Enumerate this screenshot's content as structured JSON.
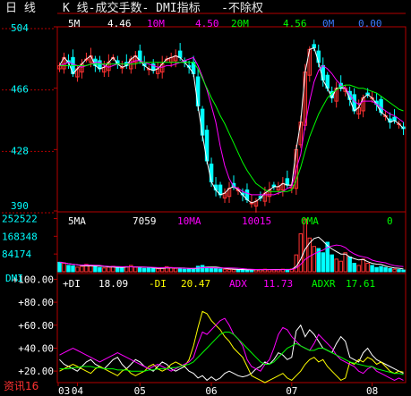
{
  "header": {
    "period": "日 线",
    "title": "K 线-成交手数- DMI指标   -不除权"
  },
  "price_legend": {
    "ma5_label": "5M",
    "ma5_value": "4.46",
    "ma10_label": "10M",
    "ma10_value": "4.50",
    "ma20_label": "20M",
    "ma20_value": "4.56",
    "ma0_label": "0M",
    "ma0_value": "0.00"
  },
  "volume_legend": {
    "ma5_label": "5MA",
    "ma5_value": "7059",
    "ma10_label": "10MA",
    "ma10_value": "10015",
    "ma0_label": "0MA",
    "ma0_value": "0"
  },
  "dmi_legend": {
    "pdi_label": "+DI",
    "pdi_value": "18.09",
    "mdi_label": "-DI",
    "mdi_value": "20.47",
    "adx_label": "ADX",
    "adx_value": "11.73",
    "adxr_label": "ADXR",
    "adxr_value": "17.61"
  },
  "panel_labels": {
    "dmi": "DMI"
  },
  "footer": {
    "brand": "资讯16"
  },
  "colors": {
    "up": "#ff3232",
    "down": "#00ffff",
    "ma5": "#ffffff",
    "ma10": "#ff00ff",
    "ma20": "#00ff00",
    "axis": "#b40000",
    "ylabel": "#00ffff",
    "pdi": "#ffffff",
    "mdi": "#ffff00",
    "adx": "#ff00ff",
    "adxr": "#00ff00"
  },
  "chart_data": [
    {
      "type": "candlestick",
      "ylim": [
        390,
        504
      ],
      "y_ticks": [
        "504",
        "466",
        "428",
        "390"
      ],
      "x_ticks": [
        "03",
        "04",
        "05",
        "06",
        "07",
        "08"
      ],
      "series": [
        {
          "name": "5M",
          "values": [
            480,
            485,
            482,
            475,
            478,
            481,
            484,
            486,
            480,
            478,
            479,
            482,
            485,
            481,
            479,
            480,
            484,
            486,
            483,
            480,
            478,
            477,
            478,
            481,
            484,
            485,
            486,
            485,
            482,
            479,
            475,
            455,
            437,
            421,
            408,
            403,
            400,
            401,
            404,
            405,
            403,
            400,
            397,
            395,
            396,
            398,
            401,
            403,
            405,
            405,
            407,
            406,
            406,
            428,
            445,
            476,
            490,
            491,
            482,
            471,
            466,
            460,
            466,
            466,
            466,
            459,
            452,
            454,
            460,
            462,
            460,
            456,
            451,
            449,
            445,
            446,
            444,
            441
          ]
        },
        {
          "name": "10M",
          "values": [
            480,
            481,
            482,
            481,
            480,
            479,
            480,
            481,
            482,
            482,
            480,
            479,
            480,
            481,
            481,
            481,
            482,
            483,
            483,
            482,
            481,
            480,
            479,
            479,
            480,
            480,
            481,
            482,
            483,
            484,
            485,
            480,
            473,
            465,
            455,
            445,
            430,
            418,
            410,
            405,
            404,
            402,
            401,
            400,
            400,
            400,
            400,
            400,
            400,
            401,
            402,
            404,
            405,
            416,
            425,
            443,
            458,
            470,
            477,
            480,
            478,
            475,
            471,
            468,
            466,
            462,
            458,
            456,
            458,
            458,
            458,
            456,
            454,
            452,
            450,
            449,
            447,
            445
          ]
        },
        {
          "name": "20M",
          "values": [
            480,
            480,
            480,
            480,
            480,
            480,
            480,
            481,
            481,
            481,
            481,
            481,
            481,
            481,
            481,
            481,
            481,
            481,
            482,
            482,
            482,
            482,
            482,
            482,
            482,
            482,
            482,
            482,
            482,
            482,
            482,
            478,
            472,
            466,
            460,
            455,
            449,
            444,
            438,
            432,
            426,
            420,
            415,
            411,
            407,
            405,
            403,
            402,
            402,
            402,
            402,
            402,
            403,
            409,
            417,
            427,
            436,
            443,
            450,
            455,
            460,
            463,
            465,
            467,
            468,
            468,
            467,
            466,
            466,
            465,
            464,
            463,
            461,
            459,
            457,
            455,
            453,
            452
          ]
        }
      ]
    },
    {
      "type": "bar",
      "ylim": [
        0,
        280000
      ],
      "y_ticks": [
        "252522",
        "168348",
        "84174"
      ],
      "series": [
        {
          "name": "volume",
          "values": [
            45000,
            40000,
            30000,
            28000,
            22000,
            26000,
            35000,
            30000,
            24000,
            20000,
            18000,
            22000,
            26000,
            20000,
            18000,
            24000,
            30000,
            22000,
            20000,
            16000,
            18000,
            15000,
            14000,
            18000,
            24000,
            20000,
            16000,
            14000,
            12000,
            14000,
            16000,
            26000,
            30000,
            22000,
            18000,
            15000,
            13000,
            12000,
            11000,
            10000,
            10000,
            9000,
            9000,
            9000,
            10000,
            11000,
            12000,
            10000,
            9000,
            10000,
            12000,
            11000,
            13000,
            80000,
            180000,
            250000,
            160000,
            120000,
            110000,
            90000,
            140000,
            80000,
            60000,
            50000,
            90000,
            70000,
            40000,
            30000,
            60000,
            40000,
            30000,
            20000,
            25000,
            20000,
            15000,
            12000,
            10000,
            8000
          ]
        }
      ]
    },
    {
      "type": "line",
      "ylim": [
        10,
        105
      ],
      "y_ticks": [
        "+100.00",
        "+80.00",
        "+60.00",
        "+40.00",
        "+20.00"
      ],
      "series": [
        {
          "name": "+DI",
          "values": [
            30,
            26,
            24,
            22,
            20,
            24,
            28,
            30,
            26,
            24,
            22,
            26,
            30,
            32,
            26,
            22,
            26,
            30,
            28,
            24,
            22,
            20,
            24,
            28,
            26,
            22,
            20,
            22,
            24,
            20,
            18,
            14,
            16,
            12,
            15,
            12,
            14,
            18,
            20,
            18,
            16,
            15,
            16,
            18,
            22,
            24,
            28,
            26,
            30,
            36,
            34,
            30,
            32,
            55,
            60,
            50,
            56,
            52,
            46,
            40,
            38,
            36,
            44,
            50,
            46,
            32,
            30,
            28,
            36,
            40,
            34,
            30,
            28,
            26,
            24,
            22,
            20,
            18
          ]
        },
        {
          "name": "-DI",
          "values": [
            20,
            22,
            24,
            26,
            24,
            22,
            20,
            18,
            22,
            24,
            22,
            20,
            18,
            16,
            20,
            22,
            18,
            16,
            18,
            20,
            24,
            26,
            22,
            20,
            22,
            26,
            28,
            26,
            24,
            30,
            42,
            58,
            72,
            70,
            64,
            60,
            56,
            50,
            46,
            40,
            36,
            32,
            24,
            16,
            14,
            12,
            10,
            12,
            14,
            16,
            18,
            14,
            12,
            16,
            20,
            26,
            30,
            32,
            28,
            30,
            24,
            20,
            16,
            12,
            14,
            28,
            26,
            30,
            28,
            32,
            30,
            26,
            28,
            24,
            20,
            18,
            20,
            19
          ]
        },
        {
          "name": "ADX",
          "values": [
            34,
            36,
            38,
            40,
            38,
            36,
            34,
            32,
            30,
            28,
            30,
            32,
            34,
            36,
            34,
            32,
            30,
            28,
            26,
            24,
            22,
            24,
            26,
            24,
            22,
            20,
            22,
            24,
            26,
            28,
            32,
            44,
            54,
            52,
            56,
            60,
            64,
            66,
            60,
            52,
            48,
            42,
            30,
            24,
            22,
            20,
            26,
            30,
            40,
            52,
            58,
            56,
            50,
            46,
            42,
            40,
            38,
            44,
            52,
            48,
            44,
            40,
            34,
            30,
            28,
            26,
            24,
            20,
            18,
            22,
            24,
            20,
            18,
            16,
            14,
            12,
            14,
            12
          ]
        },
        {
          "name": "ADXR",
          "values": [
            22,
            22,
            22,
            23,
            23,
            24,
            24,
            24,
            23,
            23,
            22,
            22,
            22,
            21,
            21,
            21,
            20,
            20,
            20,
            20,
            21,
            21,
            22,
            22,
            22,
            23,
            23,
            24,
            25,
            26,
            28,
            32,
            36,
            40,
            44,
            48,
            52,
            54,
            54,
            52,
            48,
            44,
            40,
            36,
            32,
            28,
            26,
            26,
            28,
            32,
            36,
            40,
            42,
            44,
            42,
            40,
            38,
            38,
            40,
            40,
            38,
            36,
            34,
            32,
            30,
            28,
            27,
            26,
            25,
            24,
            24,
            22,
            21,
            20,
            19,
            18,
            18,
            17
          ]
        }
      ]
    }
  ]
}
